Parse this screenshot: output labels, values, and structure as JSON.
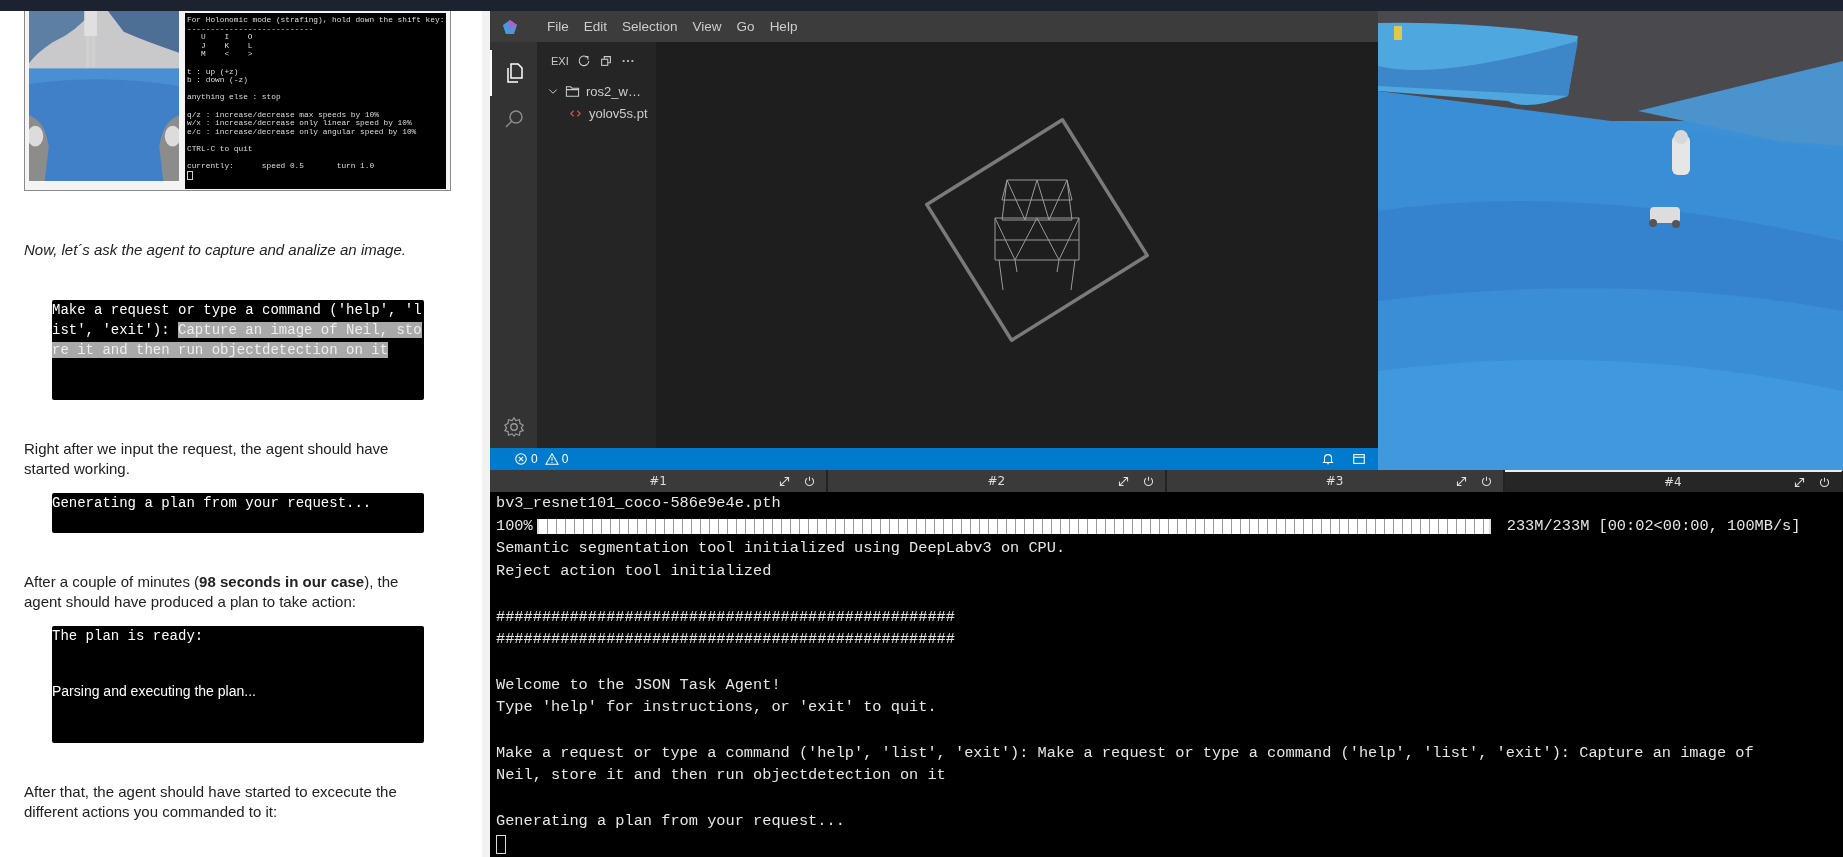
{
  "article": {
    "embedded_screenshot": {
      "terminal_lines": [
        {
          "kind": "text",
          "text": "For Holonomic mode (strafing), hold down the shift key:"
        },
        {
          "kind": "text",
          "text": "---------------------------"
        },
        {
          "kind": "text",
          "text": "   U    I    O"
        },
        {
          "kind": "text",
          "text": "   J    K    L"
        },
        {
          "kind": "text",
          "text": "   M    <    >"
        },
        {
          "kind": "blank"
        },
        {
          "kind": "text",
          "text": "t : up (+z)"
        },
        {
          "kind": "text",
          "text": "b : down (-z)"
        },
        {
          "kind": "blank"
        },
        {
          "kind": "text",
          "text": "anything else : stop"
        },
        {
          "kind": "blank"
        },
        {
          "kind": "text",
          "text": "q/z : increase/decrease max speeds by 10%"
        },
        {
          "kind": "text",
          "text": "w/x : increase/decrease only linear speed by 10%"
        },
        {
          "kind": "text",
          "text": "e/c : increase/decrease only angular speed by 10%"
        },
        {
          "kind": "blank"
        },
        {
          "kind": "text",
          "text": "CTRL-C to quit"
        },
        {
          "kind": "blank"
        },
        {
          "kind": "text",
          "text": "currently:      speed 0.5       turn 1.0"
        }
      ]
    },
    "blocks": [
      {
        "kind": "paragraph",
        "italic": true,
        "text": "Now, let´s ask the agent to capture and analize an image."
      },
      {
        "kind": "console",
        "lines": [
          {
            "kind": "mono",
            "segments": [
              {
                "text": "Make a request or type a command ('help', 'list', 'exit'): ",
                "selected": false
              },
              {
                "text": "Capture an image of Neil, store it and then run objectdetection on it",
                "selected": true
              }
            ]
          }
        ]
      },
      {
        "kind": "paragraph",
        "italic": false,
        "text": "Right after we input the request, the agent should have started working."
      },
      {
        "kind": "console",
        "lines": [
          {
            "kind": "mono",
            "segments": [
              {
                "text": "Generating a plan from your request...",
                "selected": false
              }
            ]
          }
        ]
      },
      {
        "kind": "paragraph",
        "italic": false,
        "text": "After a couple of minutes (**98 seconds in our case**), the agent should have produced a plan to take action:"
      },
      {
        "kind": "console",
        "lines": [
          {
            "kind": "mono",
            "segments": [
              {
                "text": "The plan is ready:",
                "selected": false
              }
            ]
          },
          {
            "kind": "blank"
          },
          {
            "kind": "sans",
            "segments": [
              {
                "text": "Parsing and executing the plan...",
                "selected": false
              }
            ]
          }
        ]
      },
      {
        "kind": "paragraph",
        "italic": false,
        "text": "After that, the agent should have started to excecute the different actions you commanded to it:"
      }
    ]
  },
  "editor": {
    "menu": [
      "File",
      "Edit",
      "Selection",
      "View",
      "Go",
      "Help"
    ],
    "activity_bar": [
      {
        "kind": "explorer",
        "selected": true
      },
      {
        "kind": "search",
        "selected": false
      }
    ],
    "explorer": {
      "title": "EXI",
      "tree": [
        {
          "kind": "folder",
          "label": "ros2_w…",
          "expanded": true,
          "children": [
            {
              "kind": "file",
              "label": "yolov5s.pt"
            }
          ]
        }
      ]
    },
    "status_bar": {
      "errors": "0",
      "warnings": "0"
    }
  },
  "terminal": {
    "tabs": [
      {
        "label": "#1",
        "selected": false
      },
      {
        "label": "#2",
        "selected": false
      },
      {
        "label": "#3",
        "selected": false
      },
      {
        "label": "#4",
        "selected": true
      }
    ],
    "lines": [
      {
        "kind": "text",
        "text": "bv3_resnet101_coco-586e9e4e.pth"
      },
      {
        "kind": "progress",
        "percent": "100%",
        "level": 1,
        "stats": "233M/233M [00:02<00:00, 100MB/s]"
      },
      {
        "kind": "text",
        "text": "Semantic segmentation tool initialized using DeepLabv3 on CPU."
      },
      {
        "kind": "text",
        "text": "Reject action tool initialized"
      },
      {
        "kind": "blank"
      },
      {
        "kind": "text",
        "text": "##################################################"
      },
      {
        "kind": "text",
        "text": "##################################################"
      },
      {
        "kind": "blank"
      },
      {
        "kind": "text",
        "text": "Welcome to the JSON Task Agent!"
      },
      {
        "kind": "text",
        "text": "Type 'help' for instructions, or 'exit' to quit."
      },
      {
        "kind": "blank"
      },
      {
        "kind": "text",
        "text": "Make a request or type a command ('help', 'list', 'exit'): Make a request or type a command ('help', 'list', 'exit'): Capture an image of"
      },
      {
        "kind": "text",
        "text": "Neil, store it and then run objectdetection on it"
      },
      {
        "kind": "blank"
      },
      {
        "kind": "text",
        "text": "Generating a plan from your request..."
      },
      {
        "kind": "cursor"
      }
    ]
  }
}
